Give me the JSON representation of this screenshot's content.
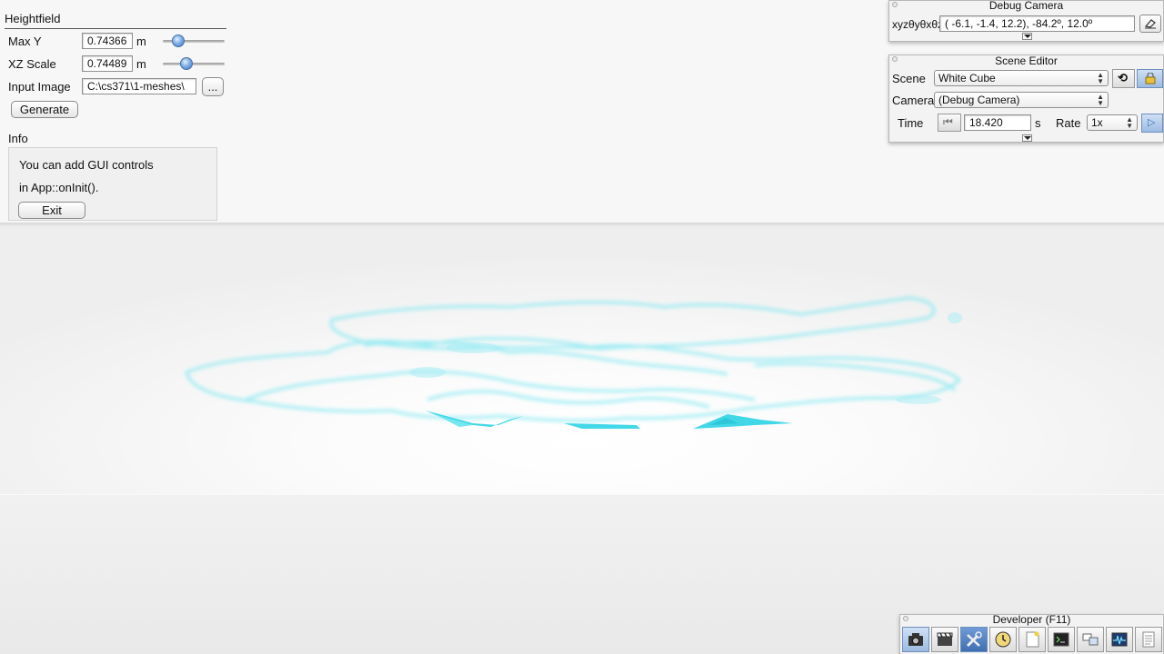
{
  "heightfield": {
    "title": "Heightfield",
    "max_y": {
      "label": "Max Y",
      "value": "0.74366",
      "unit": "m",
      "slider_fraction": 0.18
    },
    "xz_scale": {
      "label": "XZ Scale",
      "value": "0.74489",
      "unit": "m",
      "slider_fraction": 0.35
    },
    "input_image": {
      "label": "Input Image",
      "value": "C:\\cs371\\1-meshes\\",
      "browse_label": "..."
    },
    "generate_label": "Generate"
  },
  "info": {
    "title": "Info",
    "line1": "You can add GUI controls",
    "line2": "in App::onInit().",
    "exit_label": "Exit"
  },
  "debug_camera": {
    "title": "Debug Camera",
    "coord_label": "xyzθyθxθz",
    "coord_value": "( -6.1,  -1.4,  12.2), -84.2º,  12.0º"
  },
  "scene_editor": {
    "title": "Scene Editor",
    "scene_label": "Scene",
    "scene_value": "White Cube",
    "camera_label": "Camera",
    "camera_value": "(Debug Camera)",
    "time_label": "Time",
    "time_value": "18.420",
    "time_unit": "s",
    "rate_label": "Rate",
    "rate_value": "1x"
  },
  "developer": {
    "title": "Developer (F11)",
    "tools": [
      "camera-icon",
      "clapperboard-icon",
      "tools-icon",
      "clock-icon",
      "new-file-icon",
      "terminal-icon",
      "windows-icon",
      "profiler-icon",
      "document-icon"
    ]
  },
  "colors": {
    "accent": "#3a74c4",
    "mesh": "#38d6e6"
  }
}
